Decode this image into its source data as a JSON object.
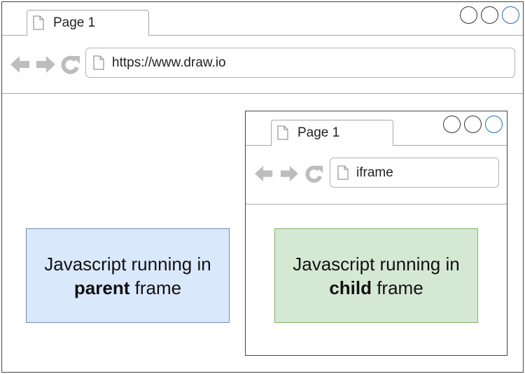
{
  "outer_browser": {
    "tab_title": "Page 1",
    "url": "https://www.draw.io",
    "icons": [
      "page-icon",
      "back-arrow-icon",
      "forward-arrow-icon",
      "reload-icon",
      "window-control-circles"
    ]
  },
  "inner_browser": {
    "tab_title": "Page 1",
    "url": "iframe"
  },
  "parent_box": {
    "line1": "Javascript running in",
    "bold": "parent",
    "suffix": " frame",
    "fill": "#dae8fc",
    "stroke": "#6c8ebf"
  },
  "child_box": {
    "line1": "Javascript running in",
    "bold": "child",
    "suffix": " frame",
    "fill": "#d5e8d4",
    "stroke": "#82b366"
  },
  "colors": {
    "control_blue": "#1f6fb3",
    "nav_gray": "#bdbdbd"
  }
}
